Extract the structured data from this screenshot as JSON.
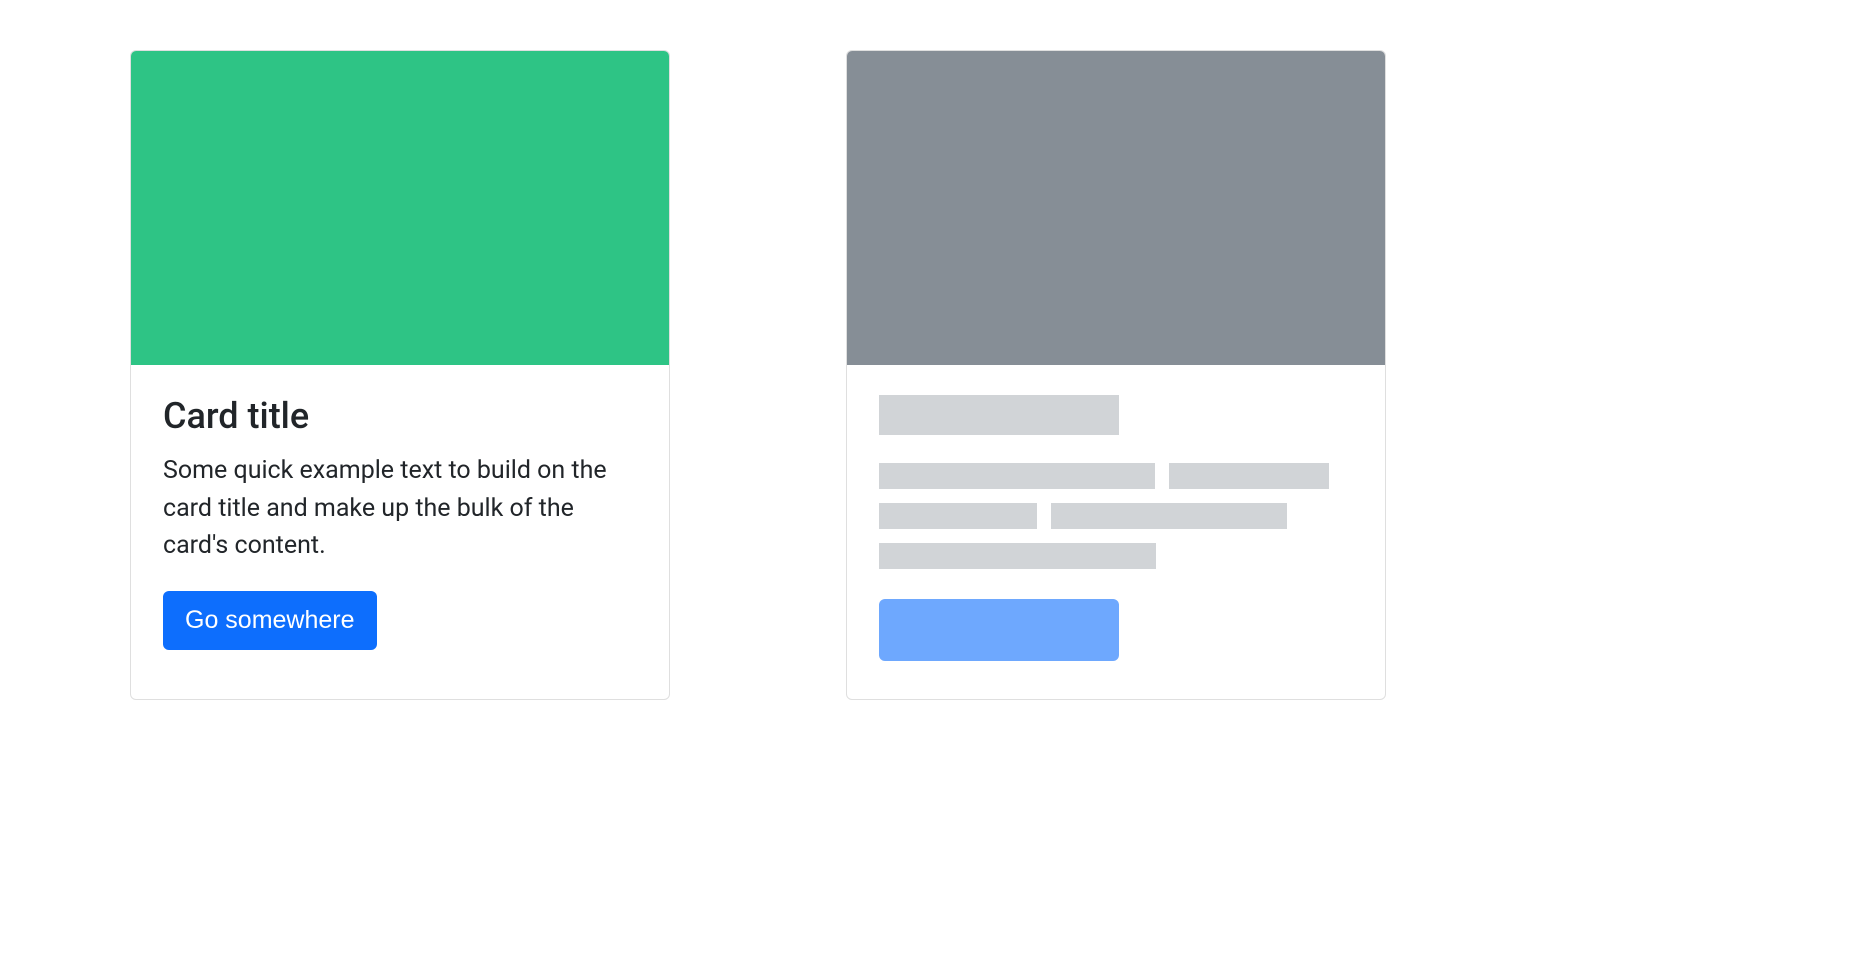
{
  "cards": [
    {
      "image_color": "#2ec485",
      "title": "Card title",
      "text": "Some quick example text to build on the card title and make up the bulk of the card's content.",
      "button_label": "Go somewhere"
    },
    {
      "image_color": "#868e96",
      "is_placeholder": true
    }
  ],
  "colors": {
    "primary": "#0d6efd",
    "placeholder_bar": "#d1d4d7",
    "placeholder_button": "#6ea8fe",
    "card_border": "rgba(0,0,0,0.125)",
    "text": "#212529"
  }
}
